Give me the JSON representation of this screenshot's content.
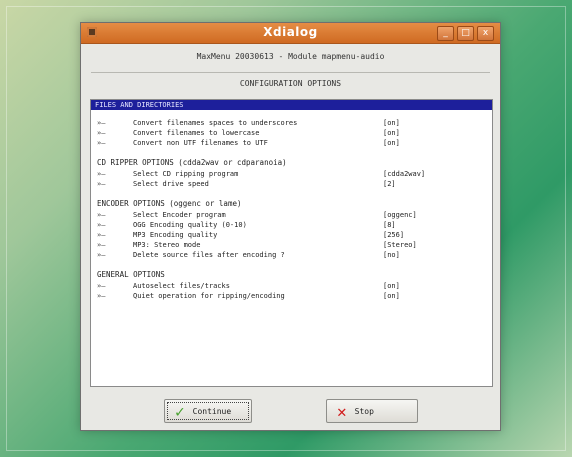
{
  "window": {
    "title": "Xdialog",
    "controls": [
      "_",
      "□",
      "x"
    ]
  },
  "dialog": {
    "header": "MaxMenu 20030613 - Module mapmenu-audio",
    "section_title": "CONFIGURATION OPTIONS",
    "selected_row": "FILES AND DIRECTORIES",
    "groups": [
      {
        "label": "",
        "items": [
          {
            "arrow": "»—",
            "label": "Convert filenames spaces to underscores",
            "value": "[on]"
          },
          {
            "arrow": "»—",
            "label": "Convert filenames to lowercase",
            "value": "[on]"
          },
          {
            "arrow": "»—",
            "label": "Convert non UTF filenames to UTF",
            "value": "[on]"
          }
        ]
      },
      {
        "label": "CD RIPPER OPTIONS (cdda2wav or cdparanoia)",
        "items": [
          {
            "arrow": "»—",
            "label": "Select CD ripping program",
            "value": "[cdda2wav]"
          },
          {
            "arrow": "»—",
            "label": "Select drive speed",
            "value": "[2]"
          }
        ]
      },
      {
        "label": "ENCODER OPTIONS (oggenc or lame)",
        "items": [
          {
            "arrow": "»—",
            "label": "Select Encoder program",
            "value": "[oggenc]"
          },
          {
            "arrow": "»—",
            "label": "OGG Encoding quality (0-10)",
            "value": "[8]"
          },
          {
            "arrow": "»—",
            "label": "MP3 Encoding quality",
            "value": "[256]"
          },
          {
            "arrow": "»—",
            "label": "MP3: Stereo mode",
            "value": "[Stereo]"
          },
          {
            "arrow": "»—",
            "label": "Delete source files after encoding ?",
            "value": "[no]"
          }
        ]
      },
      {
        "label": "GENERAL OPTIONS",
        "items": [
          {
            "arrow": "»—",
            "label": "Autoselect files/tracks",
            "value": "[on]"
          },
          {
            "arrow": "»—",
            "label": "Quiet operation for ripping/encoding",
            "value": "[on]"
          }
        ]
      }
    ]
  },
  "buttons": {
    "continue": {
      "label": "Continue",
      "icon": "checkmark-icon"
    },
    "stop": {
      "label": "Stop",
      "icon": "cross-icon"
    }
  },
  "colors": {
    "titlebar": "#d8792f",
    "selection": "#1d1f9b",
    "window_bg": "#e8e8e4",
    "panel_bg": "#ffffff",
    "check": "#48a12f",
    "stop_x": "#d11b1b"
  }
}
